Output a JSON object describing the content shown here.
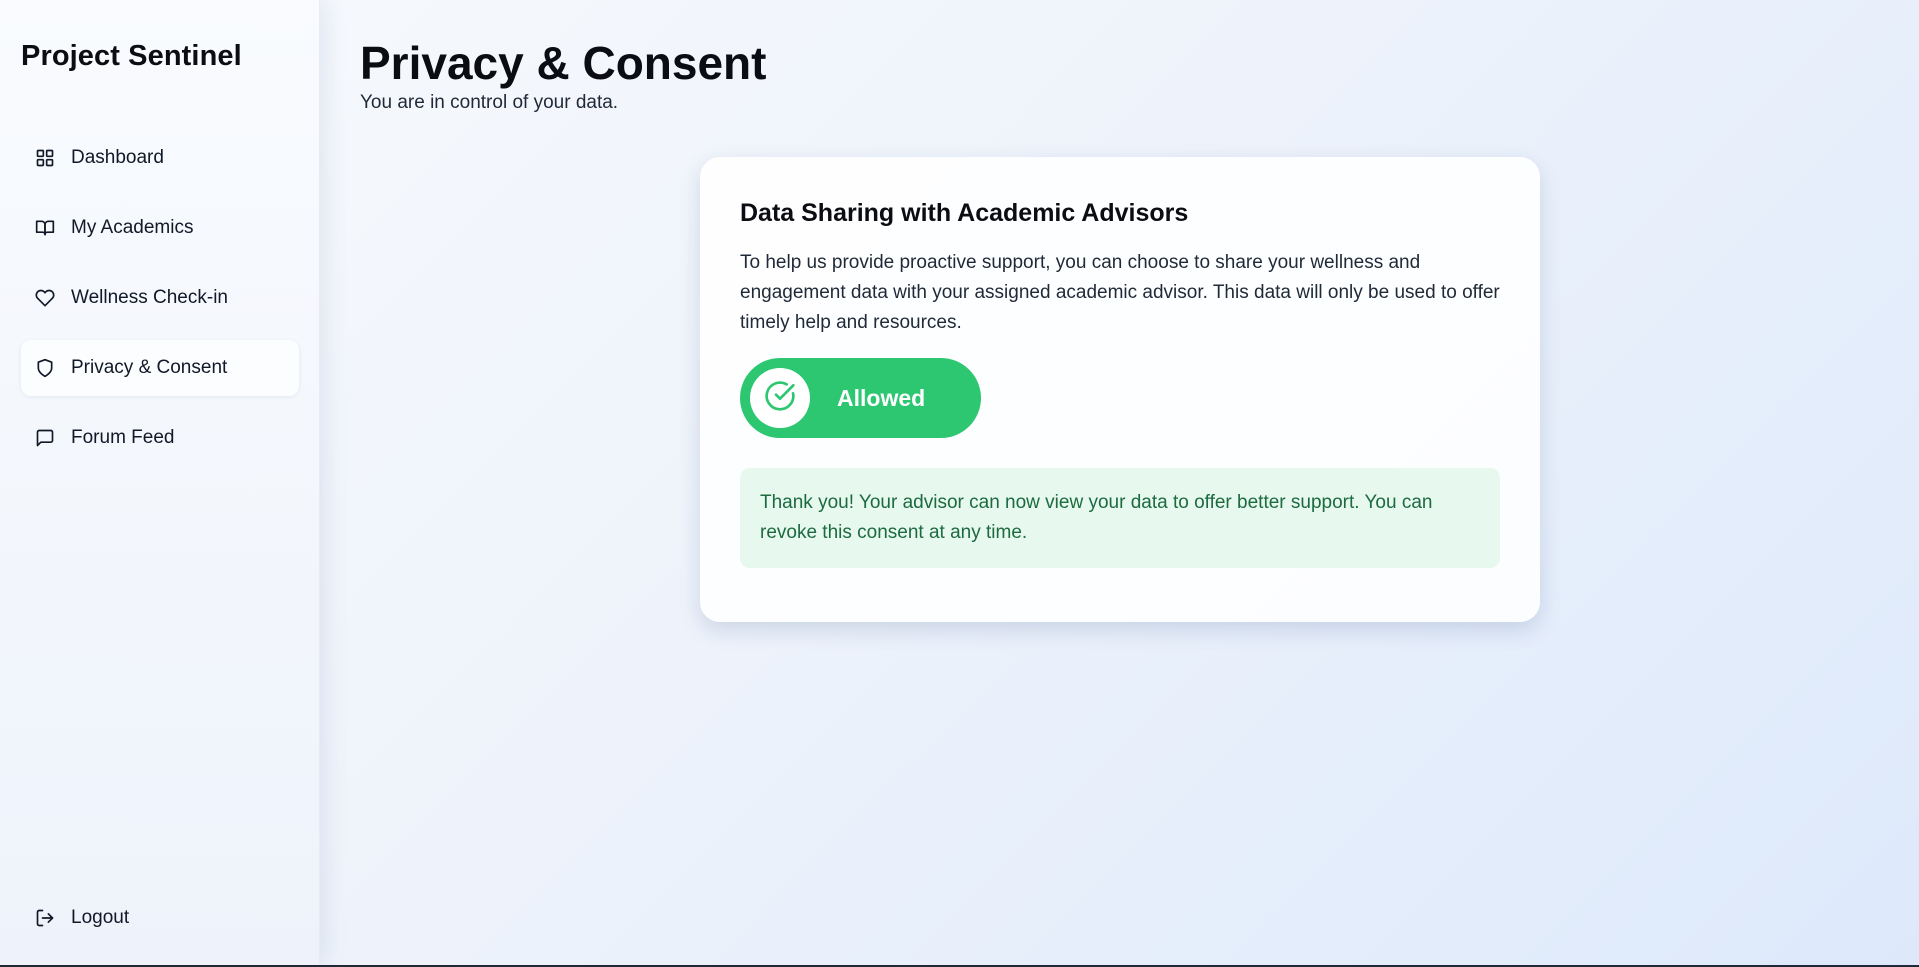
{
  "app": {
    "title": "Project Sentinel"
  },
  "sidebar": {
    "items": [
      {
        "label": "Dashboard",
        "icon": "grid-icon"
      },
      {
        "label": "My Academics",
        "icon": "book-open-icon"
      },
      {
        "label": "Wellness Check-in",
        "icon": "heart-icon"
      },
      {
        "label": "Privacy & Consent",
        "icon": "shield-icon",
        "active": true
      },
      {
        "label": "Forum Feed",
        "icon": "message-square-icon"
      }
    ],
    "logout": {
      "label": "Logout",
      "icon": "log-out-icon"
    }
  },
  "page": {
    "title": "Privacy & Consent",
    "subtitle": "You are in control of your data."
  },
  "consent_card": {
    "title": "Data Sharing with Academic Advisors",
    "description": "To help us provide proactive support, you can choose to share your wellness and engagement data with your assigned academic advisor. This data will only be used to offer timely help and resources.",
    "toggle": {
      "label": "Allowed",
      "state": "on",
      "icon": "check-circle-icon",
      "color": "#2ec771"
    },
    "notice": "Thank you! Your advisor can now view your data to offer better support. You can revoke this consent at any time."
  },
  "colors": {
    "accent_green": "#2ec771",
    "notice_bg": "#e7f8ee",
    "notice_text": "#1c6b3f"
  }
}
